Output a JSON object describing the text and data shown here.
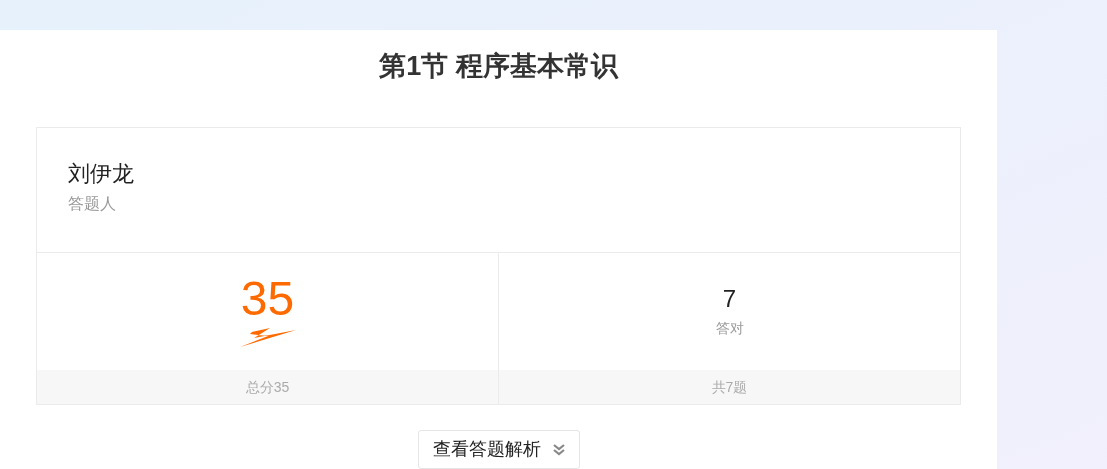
{
  "title": "第1节 程序基本常识",
  "respondent": {
    "name": "刘伊龙",
    "label": "答题人"
  },
  "stats": [
    {
      "kind": "score",
      "value": "35",
      "footer": "总分35"
    },
    {
      "kind": "count",
      "value": "7",
      "caption": "答对",
      "footer": "共7题"
    }
  ],
  "analysis_button": {
    "label": "查看答题解析"
  }
}
